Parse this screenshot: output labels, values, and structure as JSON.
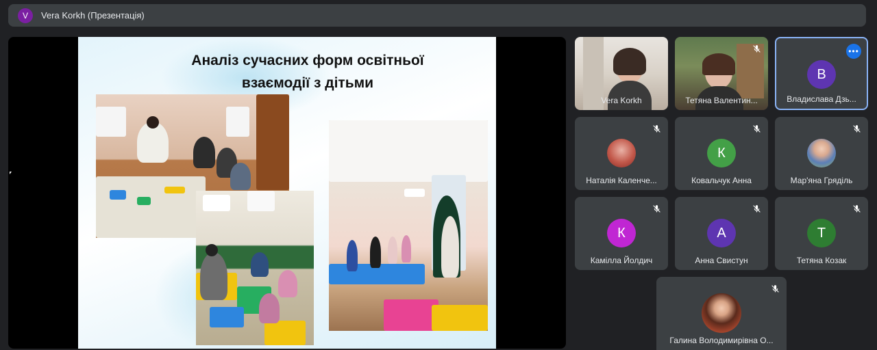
{
  "presenter_bar": {
    "avatar_letter": "V",
    "avatar_color": "#7b1fa2",
    "title": "Vera Korkh (Презентація)"
  },
  "slide": {
    "title_line1": "Аналіз сучасних форм освітньої",
    "title_line2": "взаємодії з дітьми"
  },
  "participants": [
    {
      "name": "Vera Korkh",
      "type": "video",
      "muted": false
    },
    {
      "name": "Тетяна Валентин...",
      "type": "video",
      "muted": true
    },
    {
      "name": "Владислава Дзь...",
      "type": "avatar",
      "letter": "В",
      "color": "#5e35b1",
      "muted": false,
      "active": true
    },
    {
      "name": "Наталія Каленче...",
      "type": "photo",
      "muted": true
    },
    {
      "name": "Ковальчук Анна",
      "type": "avatar",
      "letter": "К",
      "color": "#43a047",
      "muted": true
    },
    {
      "name": "Мар'яна Гряділь",
      "type": "photo",
      "muted": true
    },
    {
      "name": "Камілла Йолдич",
      "type": "avatar",
      "letter": "К",
      "color": "#c026d3",
      "muted": true
    },
    {
      "name": "Анна Свистун",
      "type": "avatar",
      "letter": "А",
      "color": "#5e35b1",
      "muted": true
    },
    {
      "name": "Тетяна Козак",
      "type": "avatar",
      "letter": "Т",
      "color": "#2e7d32",
      "muted": true
    },
    {
      "name": "Галина Володимирівна О...",
      "type": "photo",
      "muted": true
    }
  ],
  "colors": {
    "background": "#202124",
    "tile": "#3c4043",
    "active_border": "#8ab4f8",
    "more_button": "#1a73e8"
  },
  "icons": {
    "mute": "mic-off-icon",
    "more": "more-options-icon"
  }
}
